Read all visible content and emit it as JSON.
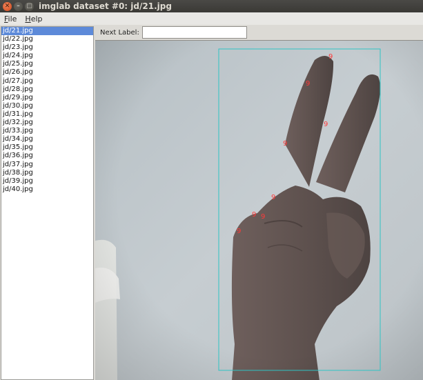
{
  "window": {
    "title": "imglab dataset #0: jd/21.jpg"
  },
  "menu": {
    "file": {
      "mnemonic": "F",
      "rest": "ile"
    },
    "help": {
      "mnemonic": "H",
      "rest": "elp"
    }
  },
  "files": [
    "jd/21.jpg",
    "jd/22.jpg",
    "jd/23.jpg",
    "jd/24.jpg",
    "jd/25.jpg",
    "jd/26.jpg",
    "jd/27.jpg",
    "jd/28.jpg",
    "jd/29.jpg",
    "jd/30.jpg",
    "jd/31.jpg",
    "jd/32.jpg",
    "jd/33.jpg",
    "jd/34.jpg",
    "jd/35.jpg",
    "jd/36.jpg",
    "jd/37.jpg",
    "jd/38.jpg",
    "jd/39.jpg",
    "jd/40.jpg"
  ],
  "selected_file": "jd/21.jpg",
  "toolbar": {
    "next_label": "Next Label:",
    "next_label_value": ""
  },
  "annotation": {
    "box_color": "#2ec4c4",
    "part_color": "#ff3a3a",
    "part_labels": [
      "9",
      "9",
      "9",
      "9",
      "9",
      "9",
      "9",
      "9"
    ]
  }
}
